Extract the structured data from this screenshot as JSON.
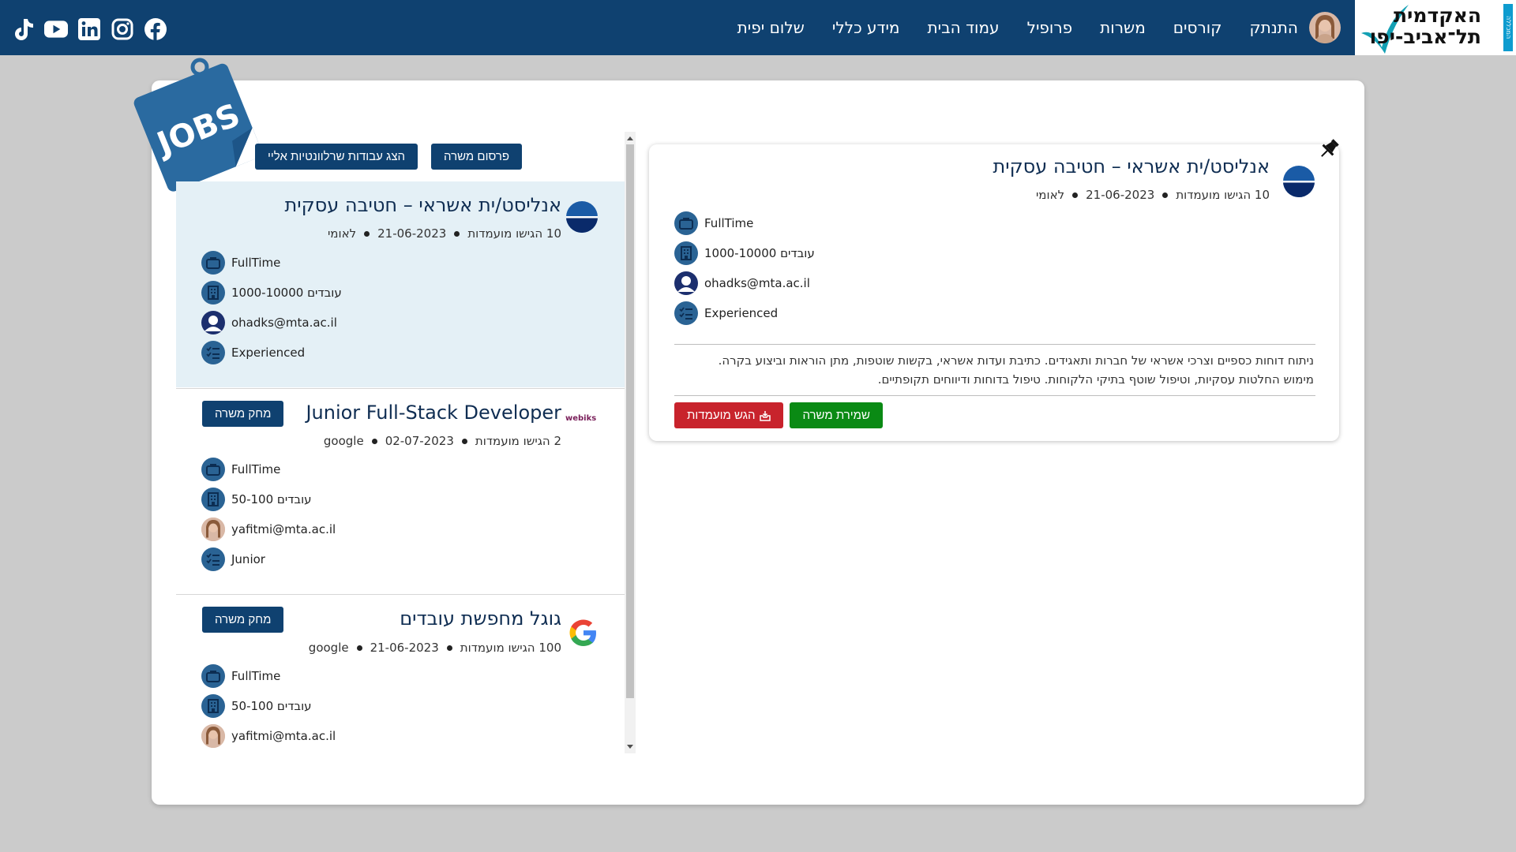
{
  "nav": {
    "logo_line1": "האקדמית",
    "logo_line2": "תל־אביב-יפו",
    "logo_side": "המכללה",
    "greeting": "שלום יפית",
    "items": [
      "מידע כללי",
      "עמוד הבית",
      "פרופיל",
      "משרות",
      "קורסים",
      "התנתק"
    ]
  },
  "social": [
    "tiktok-icon",
    "youtube-icon",
    "linkedin-icon",
    "instagram-icon",
    "facebook-icon"
  ],
  "badge": {
    "text": "JOBS"
  },
  "actions": {
    "publish_job": "פרסום משרה",
    "show_relevant": "הצג עבודות שרלוונטיות אליי"
  },
  "jobs": [
    {
      "title": "אנליסט/ית אשראי – חטיבה עסקית",
      "applicants": "10 הגישו מועמדות",
      "date": "21-06-2023",
      "company": "לאומי",
      "job_type": "FullTime",
      "size": "1000-10000 עובדים",
      "email": "ohadks@mta.ac.il",
      "level": "Experienced",
      "logo": "leumi-logo"
    },
    {
      "title": "Junior Full-Stack Developer",
      "applicants": "2 הגישו מועמדות",
      "date": "02-07-2023",
      "company": "google",
      "job_type": "FullTime",
      "size": "50-100 עובדים",
      "email": "yafitmi@mta.ac.il",
      "level": "Junior",
      "logo": "webiks-logo",
      "logo_text": "webiks",
      "delete_label": "מחק משרה"
    },
    {
      "title": "גוגל מחפשת עובדים",
      "applicants": "100 הגישו מועמדות",
      "date": "21-06-2023",
      "company": "google",
      "job_type": "FullTime",
      "size": "50-100 עובדים",
      "email": "yafitmi@mta.ac.il",
      "logo": "google-logo",
      "delete_label": "מחק משרה"
    }
  ],
  "detail": {
    "title": "אנליסט/ית אשראי – חטיבה עסקית",
    "applicants": "10 הגישו מועמדות",
    "date": "21-06-2023",
    "company": "לאומי",
    "job_type": "FullTime",
    "size": "1000-10000 עובדים",
    "email": "ohadks@mta.ac.il",
    "level": "Experienced",
    "description_line1": "ניתוח דוחות כספיים וצרכי אשראי של חברות ותאגידים. כתיבת ועדות אשראי, בקשות שוטפות, מתן הוראות וביצוע בקרה.",
    "description_line2": "מימוש החלטות עסקיות, וטיפול שוטף בתיקי הלקוחות. טיפול בדוחות ודיווחים תקופתיים.",
    "save_label": "שמירת משרה",
    "apply_label": "הגש מועמדות"
  },
  "colors": {
    "navbar": "#0f4170",
    "primary_button": "#0f4170",
    "save_button": "#0a8a14",
    "apply_button": "#c8232c",
    "selected_row": "#e4f0f6"
  }
}
